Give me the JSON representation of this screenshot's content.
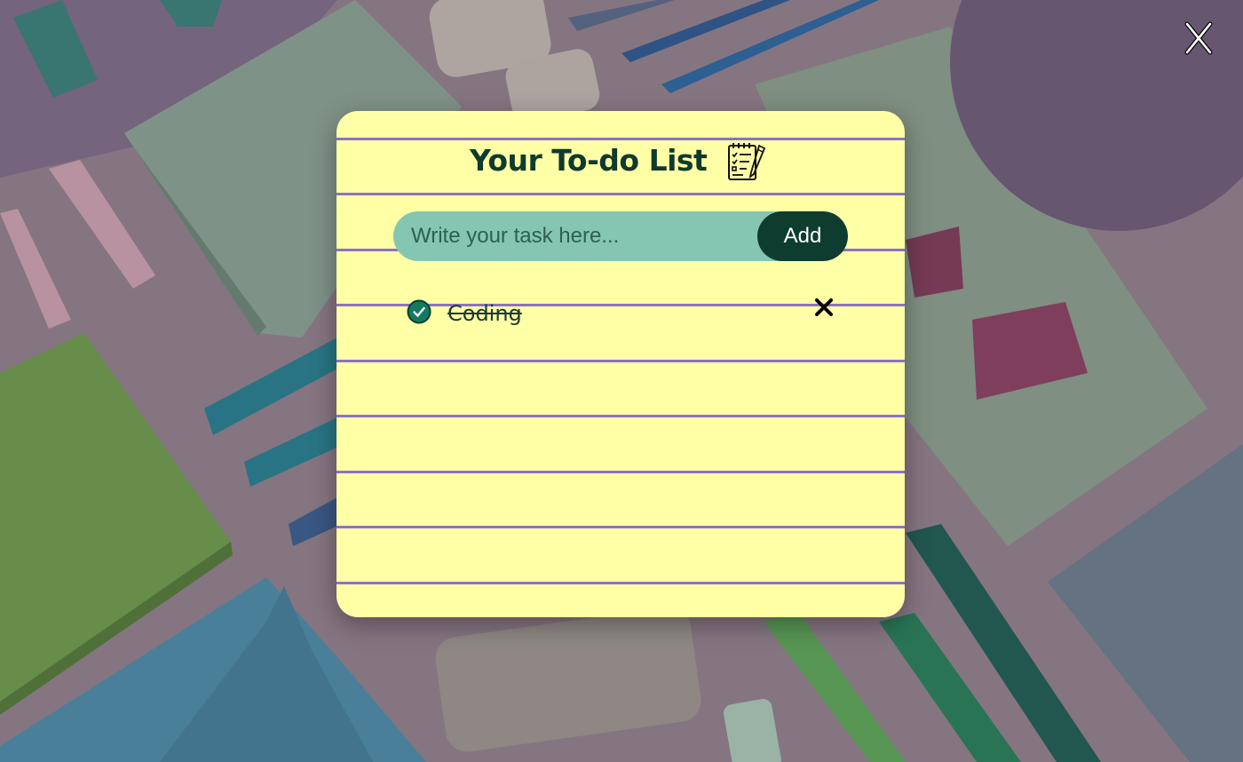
{
  "app": {
    "title": "Your To-do List",
    "title_icon": "clipboard-checklist-icon",
    "close_icon": "close-icon"
  },
  "input": {
    "placeholder": "Write your task here...",
    "value": "",
    "add_label": "Add"
  },
  "tasks": [
    {
      "text": "Coding",
      "completed": true,
      "check_icon": "check-circle-icon",
      "delete_icon": "delete-x-icon"
    }
  ],
  "colors": {
    "paper": "#ffffa6",
    "rule_lines": "#8b73c6",
    "title": "#0f3a2e",
    "input_bg": "#84c6b2",
    "button_bg": "#0e3d30",
    "button_text": "#ffffff",
    "check": "#137a5f"
  }
}
